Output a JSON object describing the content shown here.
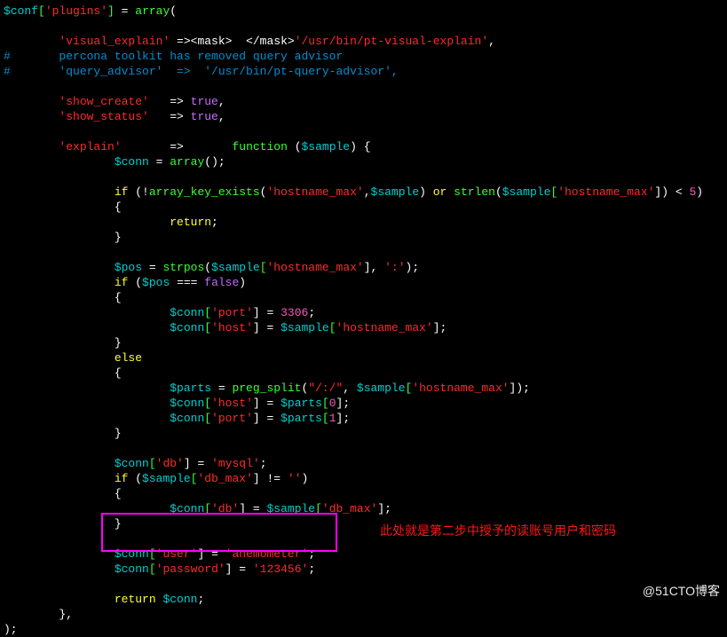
{
  "code": {
    "l1": {
      "a": "$conf",
      "b": "[",
      "c": "'plugins'",
      "d": "] ",
      "e": "= ",
      "f": "array",
      "g": "("
    },
    "l3": {
      "a": "'visual_explain'",
      "b": " =><mask>  </mask>",
      "c": "'/usr/bin/pt-visual-explain'",
      "d": ","
    },
    "l4": {
      "a": "#       percona toolkit has removed query advisor"
    },
    "l5": {
      "a": "#       'query_advisor'  =>  '/usr/bin/pt-query-advisor',"
    },
    "l7": {
      "a": "'show_create'",
      "b": "   => ",
      "c": "true",
      "d": ","
    },
    "l8": {
      "a": "'show_status'",
      "b": "   => ",
      "c": "true",
      "d": ","
    },
    "l10": {
      "a": "'explain'",
      "b": "       =>       ",
      "c": "function",
      "d": " (",
      "e": "$sample",
      "f": ") {"
    },
    "l11": {
      "a": "$conn",
      "b": " = ",
      "c": "array",
      "d": "();"
    },
    "l13": {
      "a": "if",
      "b": " (!",
      "c": "array_key_exists",
      "d": "(",
      "e": "'hostname_max'",
      "f": ",",
      "g": "$sample",
      "h": ") ",
      "i": "or",
      "j": " ",
      "k": "strlen",
      "l": "(",
      "m": "$sample",
      "n": "[",
      "o": "'hostname_max'",
      "p": "]) < ",
      "q": "5",
      "r": ")"
    },
    "l14": {
      "a": "{"
    },
    "l15": {
      "a": "return",
      "b": ";"
    },
    "l16": {
      "a": "}"
    },
    "l18": {
      "a": "$pos",
      "b": " = ",
      "c": "strpos",
      "d": "(",
      "e": "$sample",
      "f": "[",
      "g": "'hostname_max'",
      "h": "], ",
      "i": "':'",
      "j": ");"
    },
    "l19": {
      "a": "if",
      "b": " (",
      "c": "$pos",
      "d": " === ",
      "e": "false",
      "f": ")"
    },
    "l20": {
      "a": "{"
    },
    "l21": {
      "a": "$conn",
      "b": "[",
      "c": "'port'",
      "d": "] = ",
      "e": "3306",
      "f": ";"
    },
    "l22": {
      "a": "$conn",
      "b": "[",
      "c": "'host'",
      "d": "] = ",
      "e": "$sample",
      "f": "[",
      "g": "'hostname_max'",
      "h": "];"
    },
    "l23": {
      "a": "}"
    },
    "l24": {
      "a": "else"
    },
    "l25": {
      "a": "{"
    },
    "l26": {
      "a": "$parts",
      "b": " = ",
      "c": "preg_split",
      "d": "(",
      "e": "\"/:/\"",
      "f": ", ",
      "g": "$sample",
      "h": "[",
      "i": "'hostname_max'",
      "j": "]);"
    },
    "l27": {
      "a": "$conn",
      "b": "[",
      "c": "'host'",
      "d": "] = ",
      "e": "$parts",
      "f": "[",
      "g": "0",
      "h": "];"
    },
    "l28": {
      "a": "$conn",
      "b": "[",
      "c": "'port'",
      "d": "] = ",
      "e": "$parts",
      "f": "[",
      "g": "1",
      "h": "];"
    },
    "l29": {
      "a": "}"
    },
    "l31": {
      "a": "$conn",
      "b": "[",
      "c": "'db'",
      "d": "] = ",
      "e": "'mysql'",
      "f": ";"
    },
    "l32": {
      "a": "if",
      "b": " (",
      "c": "$sample",
      "d": "[",
      "e": "'db_max'",
      "f": "] != ",
      "g": "''",
      "h": ")"
    },
    "l33": {
      "a": "{"
    },
    "l34": {
      "a": "$conn",
      "b": "[",
      "c": "'db'",
      "d": "] = ",
      "e": "$sample",
      "f": "[",
      "g": "'db_max'",
      "h": "];"
    },
    "l35": {
      "a": "}"
    },
    "l37": {
      "a": "$conn",
      "b": "[",
      "c": "'user'",
      "d": "] = ",
      "e": "'anemometer'",
      "f": ";"
    },
    "l38": {
      "a": "$conn",
      "b": "[",
      "c": "'password'",
      "d": "] = ",
      "e": "'123456'",
      "f": ";"
    },
    "l40": {
      "a": "return",
      "b": " ",
      "c": "$conn",
      "d": ";"
    },
    "l41": {
      "a": "},"
    },
    "l42": {
      "a": ");"
    }
  },
  "annotation": "此处就是第二步中授予的读账号用户和密码",
  "watermark": "@51CTO博客"
}
